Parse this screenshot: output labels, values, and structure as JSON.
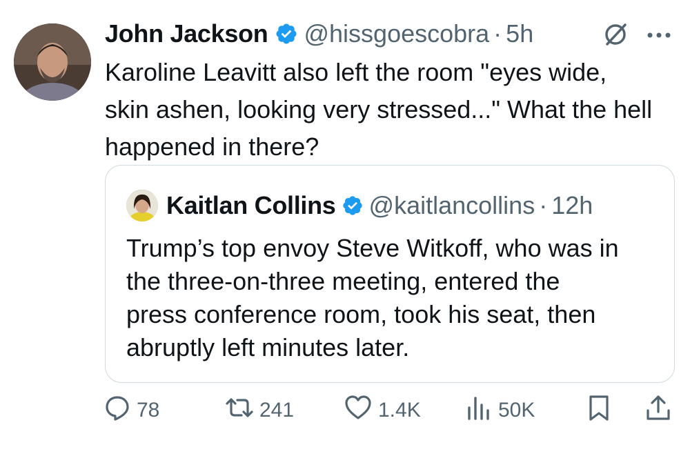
{
  "tweet": {
    "author_name": "John Jackson",
    "author_handle": "@hissgoescobra",
    "separator": "·",
    "time": "5h",
    "text": "Karoline Leavitt also left the room \"eyes wide,\nskin ashen, looking very stressed...\" What the hell\nhappened in there?",
    "verified": true
  },
  "quoted_tweet": {
    "author_name": "Kaitlan Collins",
    "author_handle": "@kaitlancollins",
    "separator": "·",
    "time": "12h",
    "text": "Trump’s top envoy Steve Witkoff, who was in\nthe three-on-three meeting, entered the\npress conference room, took his seat, then\nabruptly left minutes later.",
    "verified": true
  },
  "actions": {
    "replies": "78",
    "reposts": "241",
    "likes": "1.4K",
    "views": "50K"
  },
  "colors": {
    "verified_blue": "#1d9bf0",
    "secondary_text": "#536471",
    "border": "#cfd9de"
  },
  "icons": [
    "grok-icon",
    "more-icon",
    "reply-icon",
    "repost-icon",
    "like-icon",
    "views-icon",
    "bookmark-icon",
    "share-icon"
  ]
}
